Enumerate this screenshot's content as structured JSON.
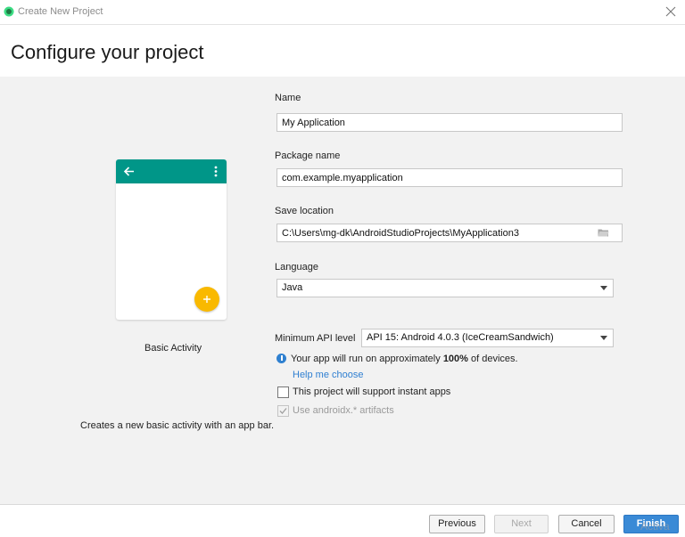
{
  "window": {
    "title": "Create New Project"
  },
  "header": {
    "title": "Configure your project"
  },
  "preview": {
    "template_name": "Basic Activity",
    "description": "Creates a new basic activity with an app bar."
  },
  "form": {
    "name": {
      "label": "Name",
      "value": "My Application"
    },
    "package": {
      "label": "Package name",
      "value": "com.example.myapplication"
    },
    "location": {
      "label": "Save location",
      "value": "C:\\Users\\mg-dk\\AndroidStudioProjects\\MyApplication3"
    },
    "language": {
      "label": "Language",
      "value": "Java"
    },
    "min_api": {
      "label": "Minimum API level",
      "value": "API 15: Android 4.0.3 (IceCreamSandwich)"
    },
    "info": {
      "prefix": "Your app will run on approximately ",
      "percent": "100%",
      "suffix": " of devices."
    },
    "help_link": "Help me choose",
    "instant_apps": {
      "label": "This project will support instant apps",
      "checked": false
    },
    "androidx": {
      "label": "Use androidx.* artifacts",
      "checked": true,
      "disabled": true
    }
  },
  "footer": {
    "previous": "Previous",
    "next": "Next",
    "cancel": "Cancel",
    "finish": "Finish"
  },
  "watermark": "Activa",
  "colors": {
    "app_bar": "#009688",
    "fab": "#f9b900",
    "accent": "#3a8ad6",
    "link": "#2f7fd1"
  }
}
